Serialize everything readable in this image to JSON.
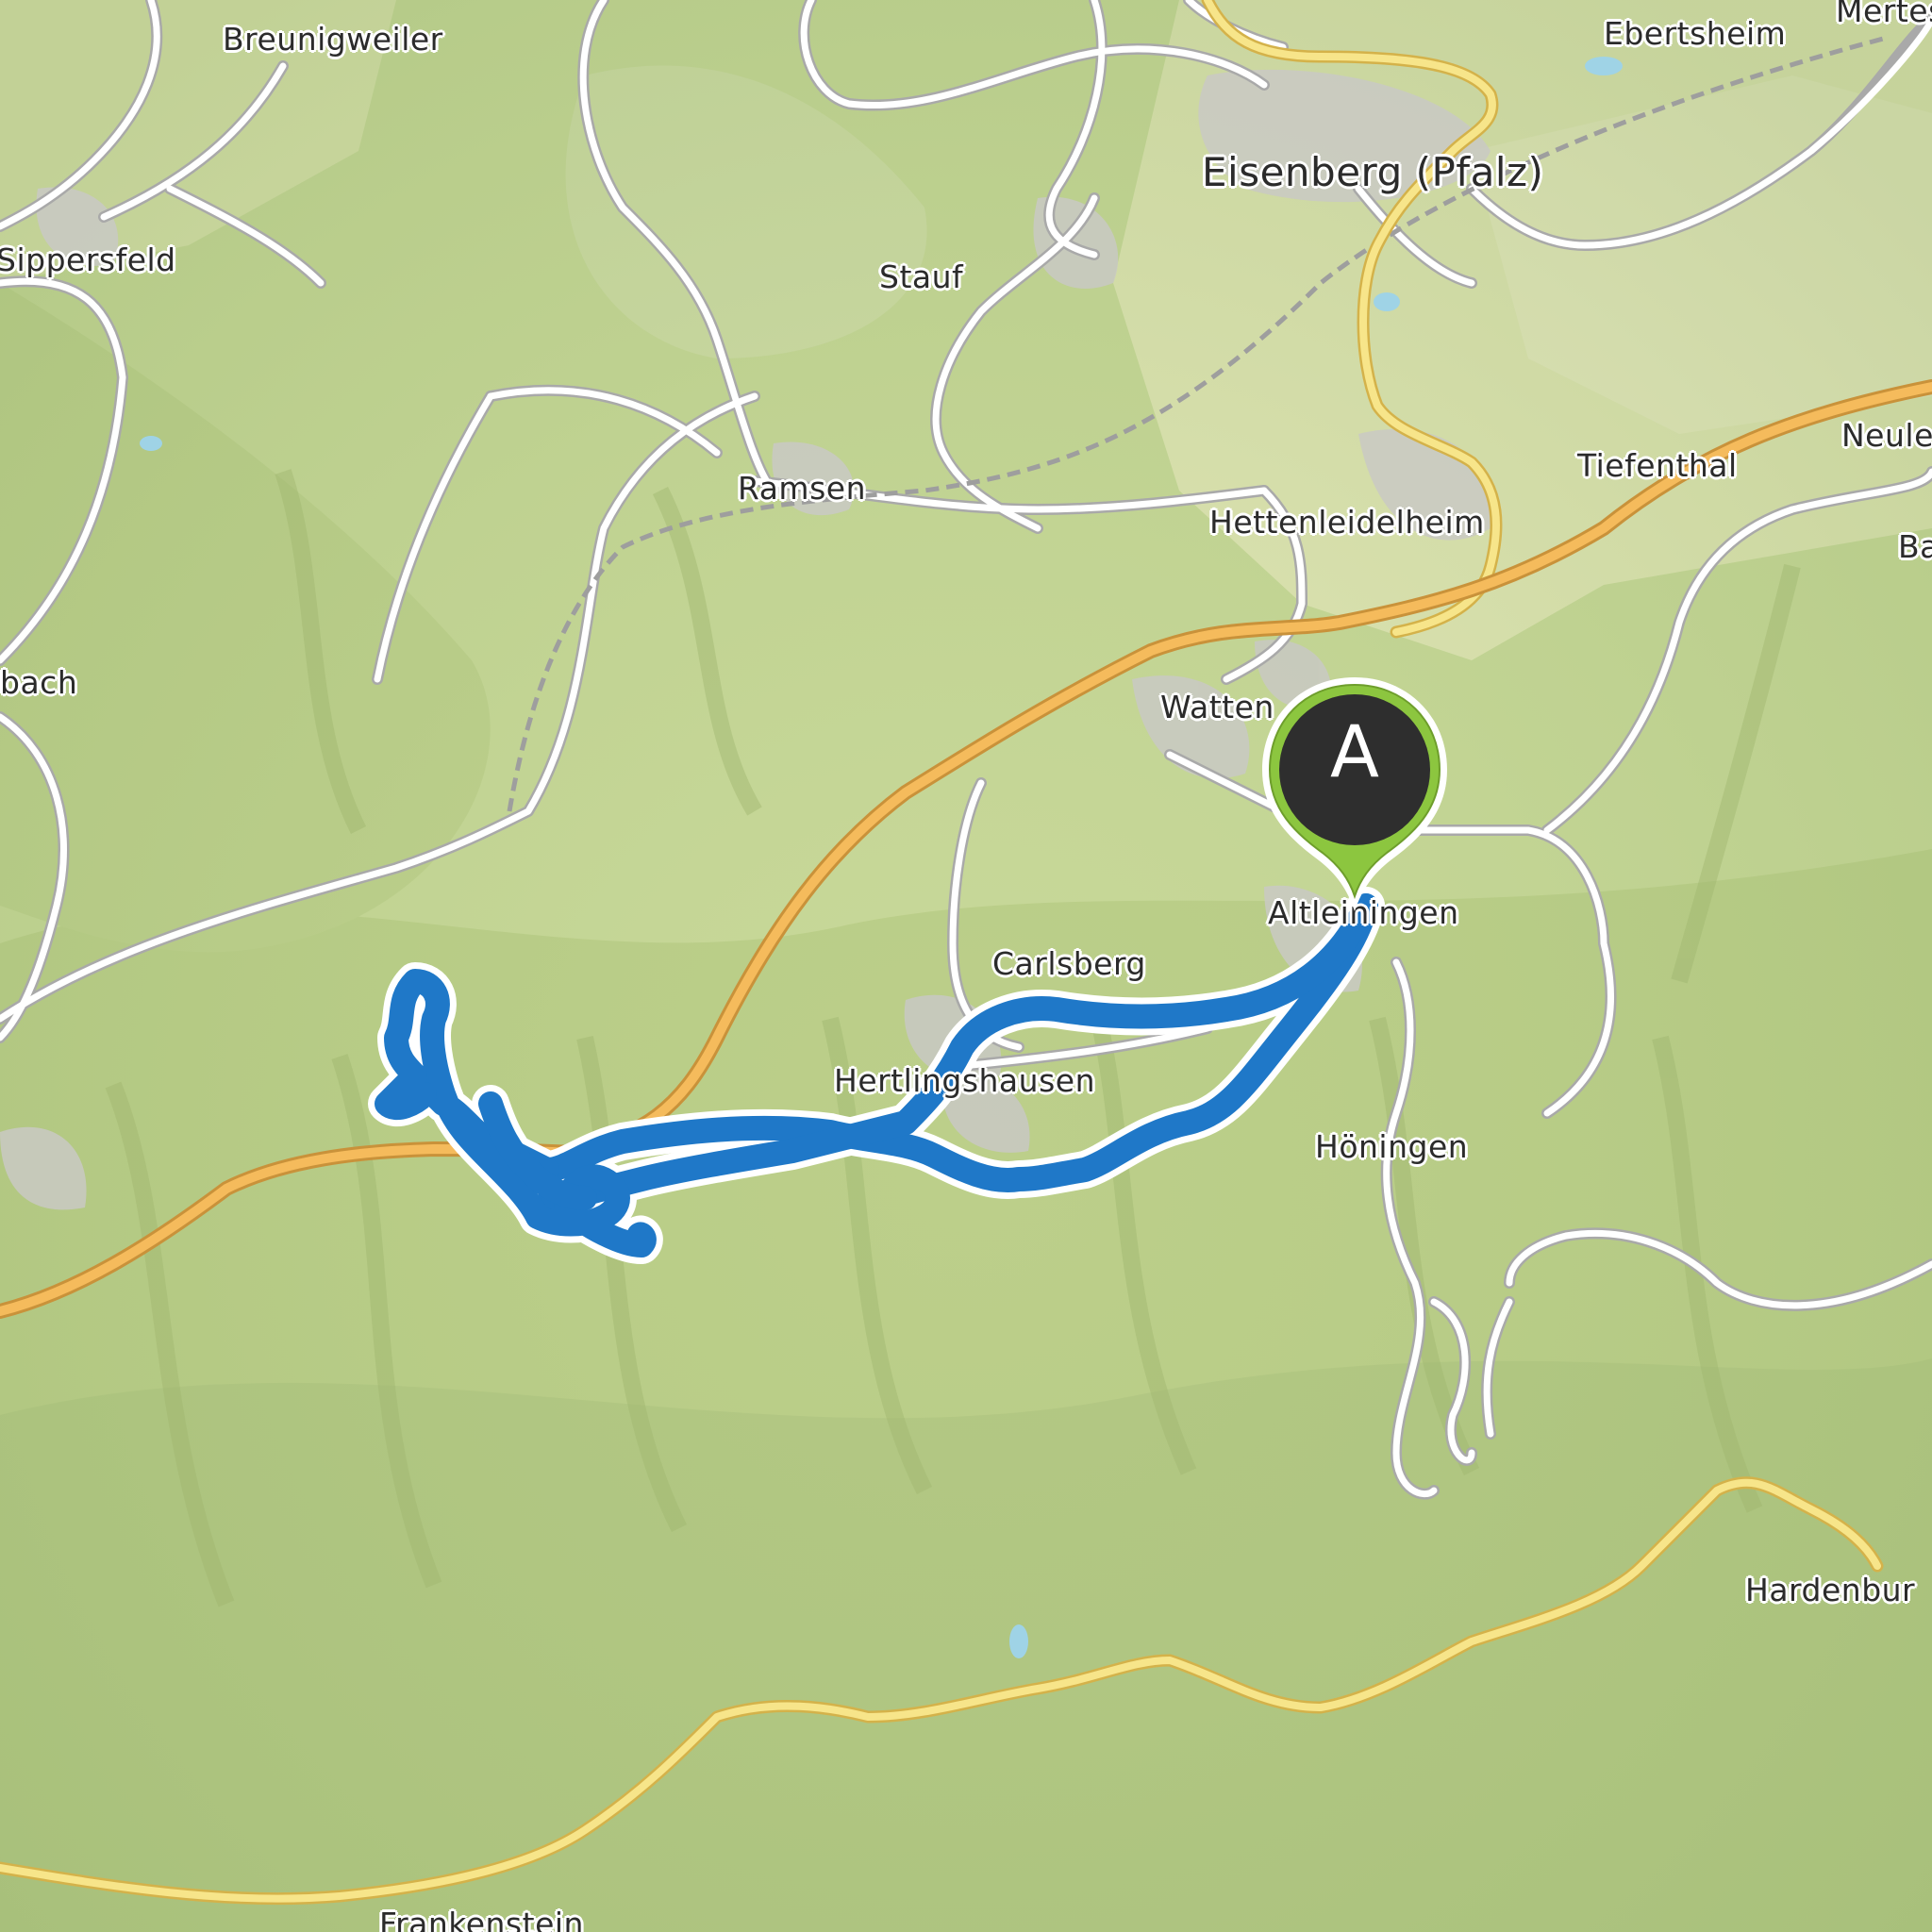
{
  "map": {
    "places": {
      "breunigweiler": "Breunigweiler",
      "ebertsheim": "Ebertsheim",
      "mertesheim": "Mertes",
      "eisenberg": "Eisenberg (Pfalz)",
      "sippersfeld": "Sippersfeld",
      "stauf": "Stauf",
      "ramsen": "Ramsen",
      "tiefenthal": "Tiefenthal",
      "neuleiningen": "Neule",
      "hettenleidelheim": "Hettenleidelheim",
      "ba": "Ba",
      "bach": "bach",
      "wattenheim": "Watten",
      "altleiningen": "Altleiningen",
      "carlsberg": "Carlsberg",
      "hertlingshausen": "Hertlingshausen",
      "hoeningen": "Höningen",
      "hardenburg": "Hardenbur",
      "frankenstein": "Frankenstein"
    },
    "start_marker": {
      "letter": "A",
      "color": "#8cc63f",
      "inner_color": "#2e2e2e"
    },
    "route_color": "#1f78c8",
    "highway_color": "#f2b557",
    "secondary_road_color": "#f7e07a"
  }
}
